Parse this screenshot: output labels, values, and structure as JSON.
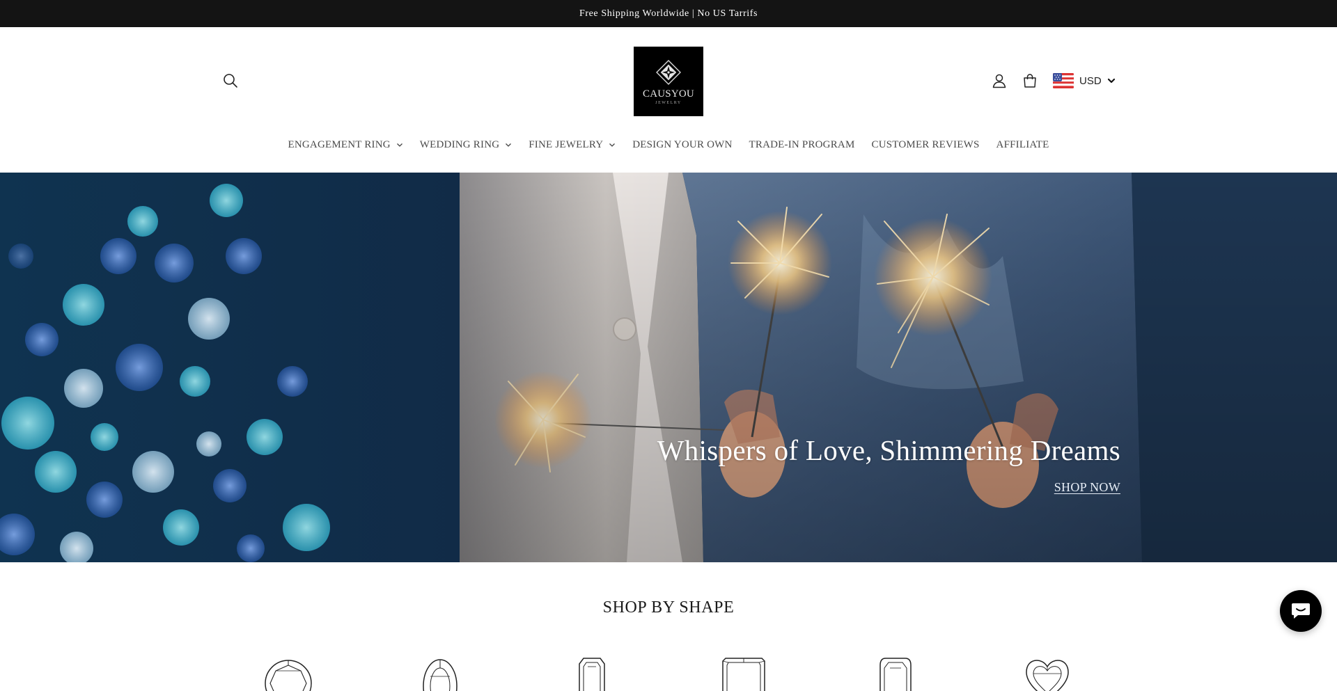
{
  "announcement": {
    "text": "Free Shipping Worldwide | No US Tarrifs"
  },
  "header": {
    "logo": {
      "wordmark": "CAUSYOU",
      "tagline": "JEWELRY"
    },
    "currency": {
      "code": "USD",
      "flag": "us-flag-icon"
    },
    "icons": [
      "search-icon",
      "account-icon",
      "cart-icon"
    ]
  },
  "nav": {
    "items": [
      {
        "label": "ENGAGEMENT RING",
        "has_dropdown": true
      },
      {
        "label": "WEDDING RING",
        "has_dropdown": true
      },
      {
        "label": "FINE JEWELRY",
        "has_dropdown": true
      },
      {
        "label": "DESIGN YOUR OWN",
        "has_dropdown": false
      },
      {
        "label": "TRADE-IN PROGRAM",
        "has_dropdown": false
      },
      {
        "label": "CUSTOMER REVIEWS",
        "has_dropdown": false
      },
      {
        "label": "AFFILIATE",
        "has_dropdown": false
      }
    ]
  },
  "hero": {
    "title": "Whispers of Love, Shimmering Dreams",
    "cta": "SHOP NOW"
  },
  "shop_by_shape": {
    "title": "SHOP BY SHAPE",
    "shapes": [
      "round-cut-icon",
      "oval-cut-icon",
      "emerald-cut-icon",
      "radiant-cut-icon",
      "elongated-cushion-cut-icon",
      "heart-cut-icon"
    ]
  },
  "colors": {
    "announcement_bg": "#141414",
    "hero_navy": "#1b3048",
    "chat_bg": "#000000"
  }
}
